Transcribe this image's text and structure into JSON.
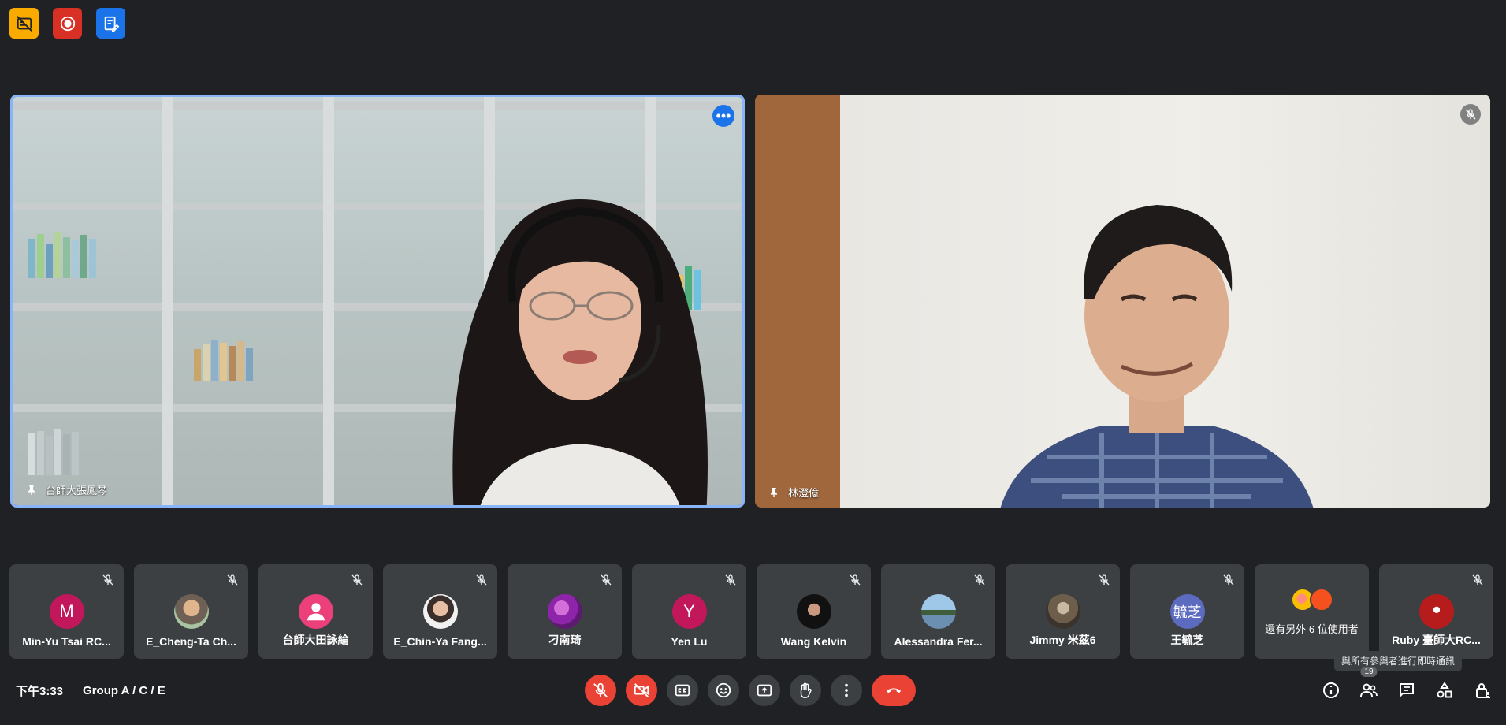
{
  "indicators": {
    "captions_off": {
      "icon": "captions-off-icon",
      "color": "#f9ab00"
    },
    "recording": {
      "icon": "record-icon",
      "color": "#d93025"
    },
    "notes": {
      "icon": "notes-icon",
      "color": "#1a73e8"
    }
  },
  "main_tiles": [
    {
      "name": "台師大張鳳琴",
      "pinned": true,
      "active_speaker": true,
      "menu_icon": "more-horiz-icon"
    },
    {
      "name": "林澄億",
      "pinned": true,
      "muted": true
    }
  ],
  "participants": [
    {
      "name": "Min-Yu Tsai RC...",
      "avatar_letter": "M",
      "avatar_color": "#c2185b",
      "muted": true
    },
    {
      "name": "E_Cheng-Ta Ch...",
      "avatar_letter": "",
      "avatar_color": "#8d6e63",
      "muted": true,
      "photo": true
    },
    {
      "name": "台師大田詠綸",
      "avatar_letter": "",
      "avatar_color": "#ec407a",
      "muted": true,
      "generic": true
    },
    {
      "name": "E_Chin-Ya Fang...",
      "avatar_letter": "",
      "avatar_color": "#e0e0e0",
      "muted": true,
      "photo": true
    },
    {
      "name": "刁南琦",
      "avatar_letter": "",
      "avatar_color": "#8e24aa",
      "muted": true,
      "photo": true
    },
    {
      "name": "Yen Lu",
      "avatar_letter": "Y",
      "avatar_color": "#c2185b",
      "muted": true
    },
    {
      "name": "Wang Kelvin",
      "avatar_letter": "",
      "avatar_color": "#212121",
      "muted": true,
      "photo": true
    },
    {
      "name": "Alessandra Fer...",
      "avatar_letter": "",
      "avatar_color": "#4a7a9a",
      "muted": true,
      "photo": true
    },
    {
      "name": "Jimmy 米茲6",
      "avatar_letter": "",
      "avatar_color": "#6d5d4b",
      "muted": true,
      "photo": true
    },
    {
      "name": "王毓芝",
      "avatar_letter": "毓芝",
      "avatar_color": "#5c6bc0",
      "muted": true
    },
    {
      "name": "Ruby 臺師大RC...",
      "avatar_letter": "",
      "avatar_color": "#b71c1c",
      "muted": true,
      "photo": true
    }
  ],
  "others": {
    "label": "還有另外 6 位使用者",
    "colors": [
      "#fbbc04",
      "#f4511e"
    ]
  },
  "tooltip": "與所有參與者進行即時通訊",
  "bottom": {
    "time": "下午3:33",
    "meeting_name": "Group A / C / E",
    "people_count": "19"
  },
  "colors": {
    "background": "#202124",
    "tile": "#3c4043",
    "accent": "#8ab4f8",
    "danger": "#ea4335"
  }
}
